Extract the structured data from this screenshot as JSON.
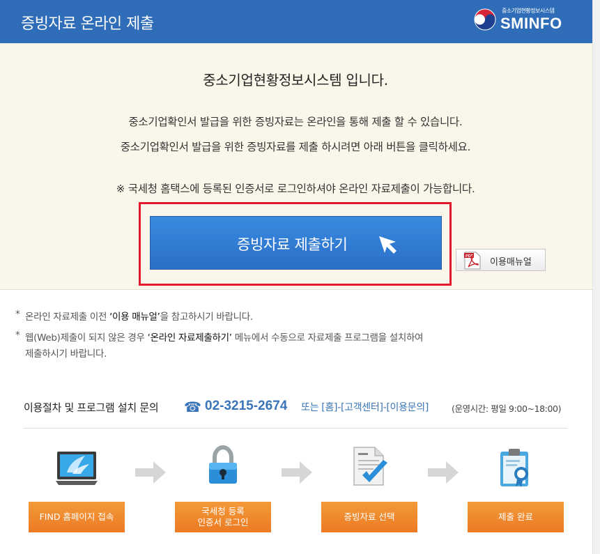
{
  "header": {
    "title": "증빙자료 온라인 제출",
    "logo_sub": "중소기업현황정보시스템",
    "logo_main": "SMINFO"
  },
  "hero": {
    "title": "중소기업현황정보시스템 입니다.",
    "line1": "중소기업확인서 발급을 위한 증빙자료는 온라인을 통해 제출 할 수 있습니다.",
    "line2": "중소기업확인서 발급을 위한 증빙자료를 제출 하시려면 아래 버튼을 클릭하세요.",
    "notice": "※  국세청 홈택스에 등록된 인증서로 로그인하셔야 온라인 자료제출이 가능합니다.",
    "submit_label": "증빙자료 제출하기",
    "manual_label": "이용매뉴얼",
    "pdf_badge": "PDF"
  },
  "notes": {
    "n1_star": "*",
    "n1_pre": "온라인 자료제출 이전 ",
    "n1_em": "‘이용 매뉴얼’",
    "n1_post": "을 참고하시기 바랍니다.",
    "n2_star": "*",
    "n2_pre": "웹(Web)제출이 되지 않은 경우 ",
    "n2_em": "‘온라인 자료제출하기’",
    "n2_post": " 메뉴에서 수동으로 자료제출 프로그램을 설치하여",
    "n2_cont": "제출하시기 바랍니다."
  },
  "contact": {
    "label": "이용절차 및 프로그램 설치 문의",
    "phone_icon": "☎",
    "phone": "02-3215-2674",
    "menu": "또는 [홈]-[고객센터]-[이용문의]",
    "hours": "(운영시간: 평일 9:00~18:00)"
  },
  "steps": [
    {
      "icon": "monitor-icon",
      "label": "FIND 홈페이지 접속"
    },
    {
      "icon": "lock-icon",
      "label": "국세청 등록\n인증서 로그인"
    },
    {
      "icon": "document-check-icon",
      "label": "증빙자료 선택"
    },
    {
      "icon": "clipboard-badge-icon",
      "label": "제출 완료"
    }
  ],
  "colors": {
    "header_bg": "#2f6db9",
    "hero_bg": "#faf7ea",
    "highlight_border": "#e0182a",
    "submit_btn": "#2a7ad4",
    "step_btn": "#ef8530",
    "phone_text": "#3a74b8"
  }
}
